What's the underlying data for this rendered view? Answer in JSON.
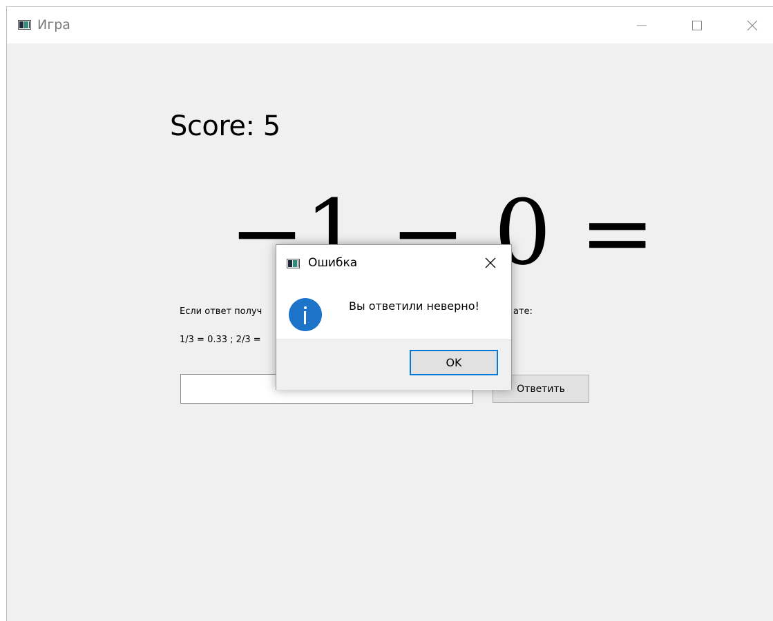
{
  "window": {
    "title": "Игра",
    "controls": {
      "minimize": "minimize-icon",
      "maximize": "maximize-icon",
      "close": "close-icon"
    }
  },
  "game": {
    "score_label": "Score: 5",
    "equation": "−1 − 0 =",
    "hint_line_1": "Если ответ получ",
    "hint_line_1_end": "ате:",
    "hint_line_2": "1/3 = 0.33 ; 2/3 =",
    "answer_value": "",
    "submit_label": "Ответить"
  },
  "dialog": {
    "title": "Ошибка",
    "message": "Вы ответили неверно!",
    "ok_label": "OK",
    "icon": "info-icon"
  },
  "colors": {
    "accent": "#0078d7",
    "info_icon": "#1c73c8",
    "background": "#f0f0f0"
  }
}
